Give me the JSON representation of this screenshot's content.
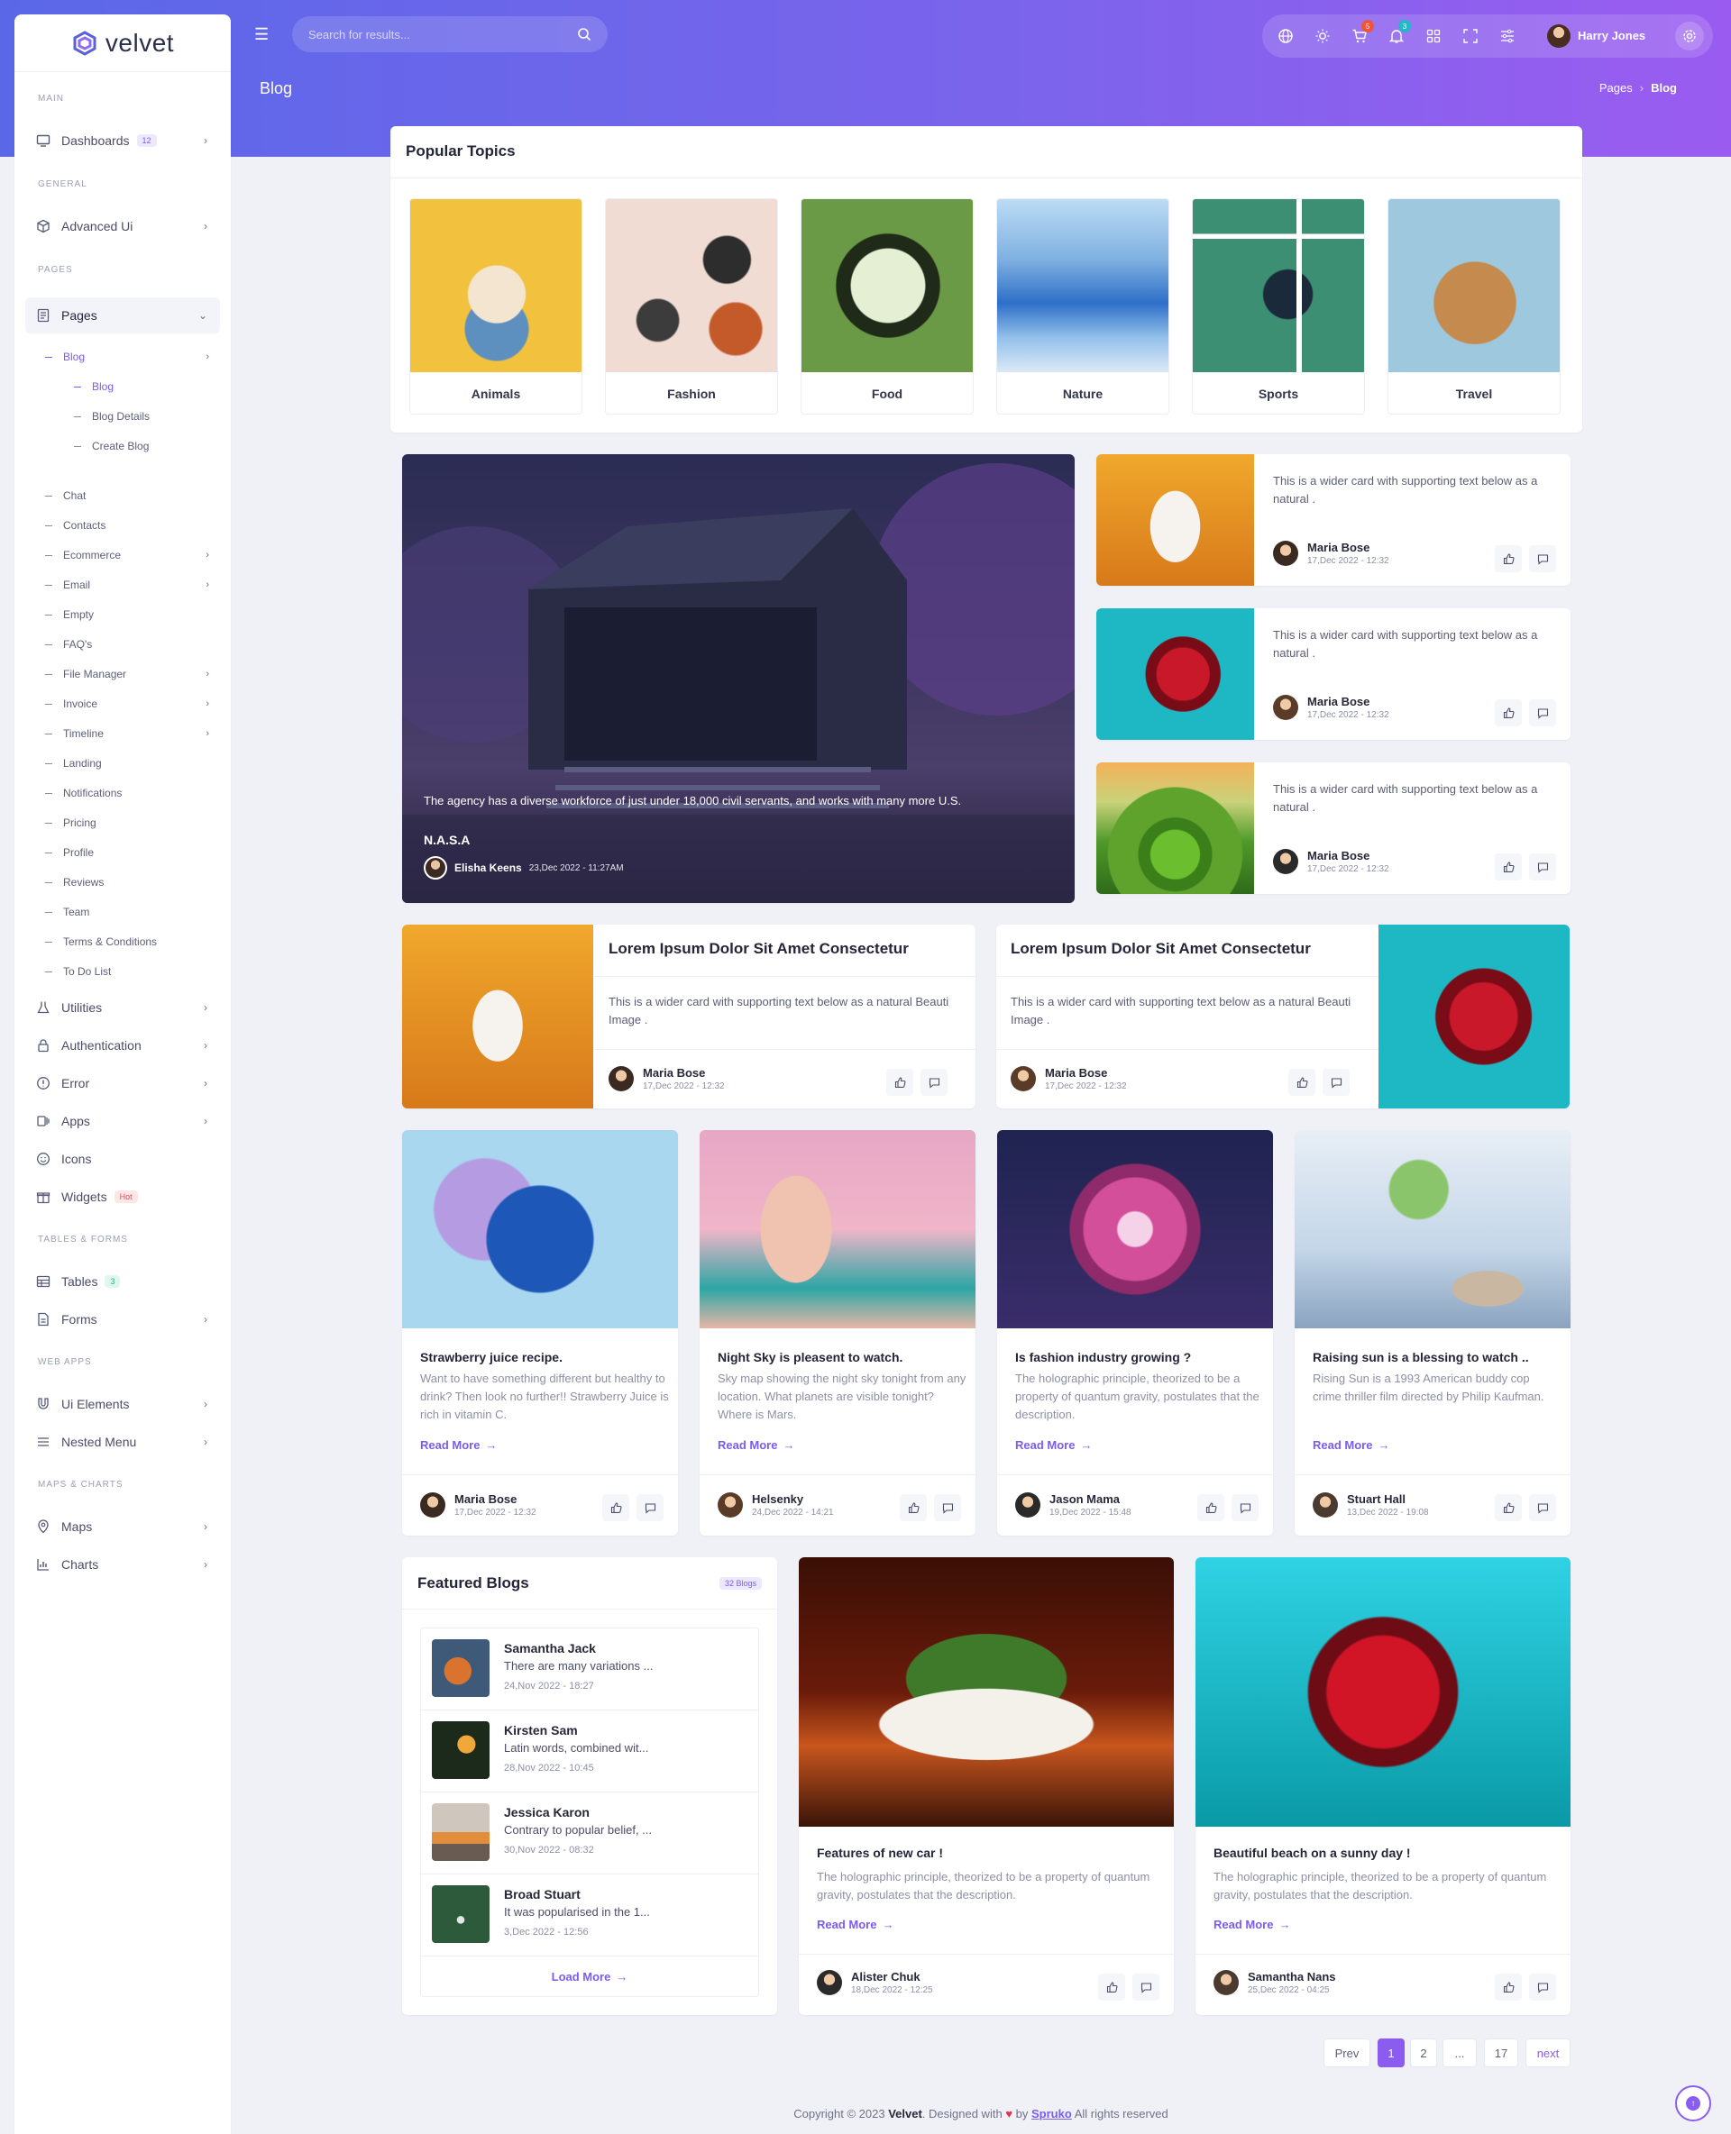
{
  "app": {
    "name": "velvet"
  },
  "sidebar": {
    "cats": {
      "main": "MAIN",
      "general": "GENERAL",
      "pages": "PAGES",
      "tables": "TABLES & FORMS",
      "webapps": "WEB APPS",
      "maps": "MAPS & CHARTS"
    },
    "dashboards": {
      "label": "Dashboards",
      "badge": "12"
    },
    "advanced": "Advanced Ui",
    "pages": "Pages",
    "blog": "Blog",
    "blog_sub": [
      "Blog",
      "Blog Details",
      "Create Blog"
    ],
    "page_items": [
      "Chat",
      "Contacts",
      "Ecommerce",
      "Email",
      "Empty",
      "FAQ's",
      "File Manager",
      "Invoice",
      "Timeline",
      "Landing",
      "Notifications",
      "Pricing",
      "Profile",
      "Reviews",
      "Team",
      "Terms & Conditions",
      "To Do List"
    ],
    "utilities": "Utilities",
    "auth": "Authentication",
    "error": "Error",
    "apps": "Apps",
    "icons": "Icons",
    "widgets": {
      "label": "Widgets",
      "badge": "Hot"
    },
    "tables": {
      "label": "Tables",
      "badge": "3"
    },
    "forms": "Forms",
    "ui_elements": "Ui Elements",
    "nested": "Nested Menu",
    "maps": "Maps",
    "charts": "Charts"
  },
  "header": {
    "search_placeholder": "Search for results...",
    "cart_count": "5",
    "notif_count": "3",
    "user": "Harry Jones",
    "page_title": "Blog",
    "crumb1": "Pages",
    "crumb2": "Blog"
  },
  "topics": {
    "title": "Popular Topics",
    "items": [
      "Animals",
      "Fashion",
      "Food",
      "Nature",
      "Sports",
      "Travel"
    ]
  },
  "hero": {
    "text": "The agency has a diverse workforce of just under 18,000 civil servants, and works with many more U.S.",
    "title": "N.A.S.A",
    "author": "Elisha Keens",
    "date": "23,Dec 2022 - 11:27AM"
  },
  "side_cards": [
    {
      "text": "This is a wider card with supporting text below as a natural .",
      "name": "Maria Bose",
      "date": "17,Dec 2022 - 12:32"
    },
    {
      "text": "This is a wider card with supporting text below as a natural .",
      "name": "Maria Bose",
      "date": "17,Dec 2022 - 12:32"
    },
    {
      "text": "This is a wider card with supporting text below as a natural .",
      "name": "Maria Bose",
      "date": "17,Dec 2022 - 12:32"
    }
  ],
  "wide_cards": [
    {
      "title": "Lorem Ipsum Dolor Sit Amet Consectetur",
      "text": "This is a wider card with supporting text below as a natural Beauti Image .",
      "name": "Maria Bose",
      "date": "17,Dec 2022 - 12:32"
    },
    {
      "title": "Lorem Ipsum Dolor Sit Amet Consectetur",
      "text": "This is a wider card with supporting text below as a natural Beauti Image .",
      "name": "Maria Bose",
      "date": "17,Dec 2022 - 12:32"
    }
  ],
  "read_more": "Read More",
  "posts": [
    {
      "title": "Strawberry juice recipe.",
      "text": "Want to have something different but healthy to drink? Then look no further!! Strawberry Juice is rich in vitamin C.",
      "name": "Maria Bose",
      "date": "17,Dec 2022 - 12:32"
    },
    {
      "title": "Night Sky is pleasent to watch.",
      "text": "Sky map showing the night sky tonight from any location. What planets are visible tonight? Where is Mars.",
      "name": "Helsenky",
      "date": "24,Dec 2022 - 14:21"
    },
    {
      "title": "Is fashion industry growing ?",
      "text": "The holographic principle, theorized to be a property of quantum gravity, postulates that the description.",
      "name": "Jason Mama",
      "date": "19,Dec 2022 - 15:48"
    },
    {
      "title": "Raising sun is a blessing to watch ..",
      "text": "Rising Sun is a 1993 American buddy cop crime thriller film directed by Philip Kaufman.",
      "name": "Stuart Hall",
      "date": "13,Dec 2022 - 19:08"
    }
  ],
  "featured": {
    "title": "Featured Blogs",
    "badge": "32 Blogs",
    "load_more": "Load More",
    "items": [
      {
        "name": "Samantha Jack",
        "text": "There are many variations ...",
        "date": "24,Nov 2022 - 18:27"
      },
      {
        "name": "Kirsten Sam",
        "text": "Latin words, combined wit...",
        "date": "28,Nov 2022 - 10:45"
      },
      {
        "name": "Jessica Karon",
        "text": "Contrary to popular belief, ...",
        "date": "30,Nov 2022 - 08:32"
      },
      {
        "name": "Broad Stuart",
        "text": "It was popularised in the 1...",
        "date": "3,Dec 2022 - 12:56"
      }
    ]
  },
  "big_posts": [
    {
      "title": "Features of new car !",
      "text": "The holographic principle, theorized to be a property of quantum gravity, postulates that the description.",
      "name": "Alister Chuk",
      "date": "18,Dec 2022 - 12:25"
    },
    {
      "title": "Beautiful beach on a sunny day !",
      "text": "The holographic principle, theorized to be a property of quantum gravity, postulates that the description.",
      "name": "Samantha Nans",
      "date": "25,Dec 2022 - 04:25"
    }
  ],
  "pagination": {
    "prev": "Prev",
    "p1": "1",
    "p2": "2",
    "dots": "...",
    "last": "17",
    "next": "next"
  },
  "footer": {
    "pre": "Copyright © 2023",
    "brand": "Velvet",
    "mid": ". Designed with",
    "by": "by",
    "link": "Spruko",
    "post": "All rights reserved"
  }
}
